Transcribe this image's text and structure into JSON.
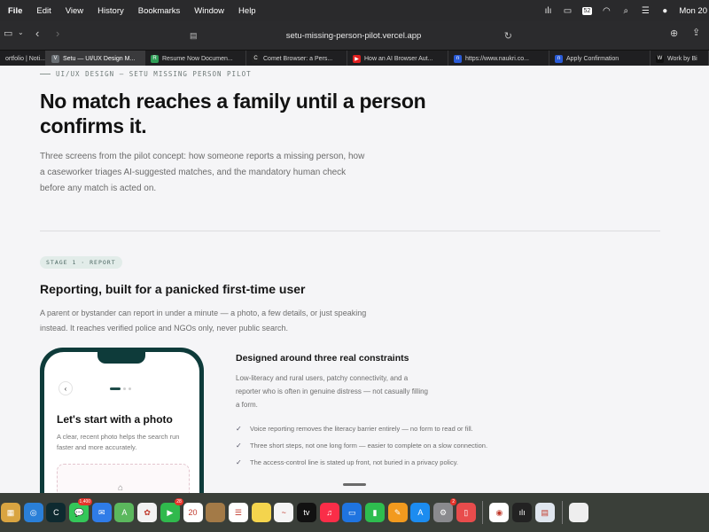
{
  "menubar": {
    "items": [
      "File",
      "Edit",
      "View",
      "History",
      "Bookmarks",
      "Window",
      "Help"
    ],
    "battery_badge": "52",
    "clock": "Mon 20"
  },
  "toolbar": {
    "url": "setu-missing-person-pilot.vercel.app"
  },
  "tabs": [
    {
      "label": "ortfolio | Noti...",
      "fav": "#444444",
      "glyph": "",
      "active": false
    },
    {
      "label": "Setu — UI/UX Design M...",
      "fav": "#6a6f74",
      "glyph": "V",
      "active": true
    },
    {
      "label": "Resume Now Documen...",
      "fav": "#2f9e57",
      "glyph": "R",
      "active": false
    },
    {
      "label": "Comet Browser: a Pers...",
      "fav": "#222222",
      "glyph": "C",
      "active": false
    },
    {
      "label": "How an AI Browser Aut...",
      "fav": "#e02020",
      "glyph": "▶",
      "active": false
    },
    {
      "label": "https://www.naukri.co...",
      "fav": "#2a5bd7",
      "glyph": "n",
      "active": false
    },
    {
      "label": "Apply Confirmation",
      "fav": "#2a5bd7",
      "glyph": "n",
      "active": false
    },
    {
      "label": "Work by Bi",
      "fav": "#111111",
      "glyph": "W",
      "active": false
    }
  ],
  "page": {
    "eyebrow": "UI/UX DESIGN — SETU MISSING PERSON PILOT",
    "hero_title": "No match reaches a family until a person confirms it.",
    "hero_sub": "Three screens from the pilot concept: how someone reports a missing person, how a caseworker triages AI-suggested matches, and the mandatory human check before any match is acted on.",
    "stage_label": "STAGE 1 · REPORT",
    "section_title": "Reporting, built for a panicked first-time user",
    "section_sub": "A parent or bystander can report in under a minute — a photo, a few details, or just speaking instead. It reaches verified police and NGOs only, never public search.",
    "phone": {
      "title": "Let's start with a photo",
      "subtitle": "A clear, recent photo helps the search run faster and more accurately."
    },
    "constraints": {
      "title": "Designed around three real constraints",
      "intro": "Low-literacy and rural users, patchy connectivity, and a reporter who is often in genuine distress — not casually filling a form.",
      "items": [
        "Voice reporting removes the literacy barrier entirely — no form to read or fill.",
        "Three short steps, not one long form — easier to complete on a slow connection.",
        "The access-control line is stated up front, not buried in a privacy policy."
      ]
    }
  },
  "dock": {
    "apps": [
      {
        "name": "launchpad-icon",
        "color": "#d9a441",
        "glyph": "▦",
        "badge": ""
      },
      {
        "name": "safari-icon",
        "color": "#2a7fd8",
        "glyph": "◎",
        "badge": ""
      },
      {
        "name": "comet-icon",
        "color": "#0e2a30",
        "glyph": "C",
        "badge": ""
      },
      {
        "name": "messages-icon",
        "color": "#34c759",
        "glyph": "💬",
        "badge": "1,400"
      },
      {
        "name": "mail-icon",
        "color": "#2f7ce8",
        "glyph": "✉",
        "badge": ""
      },
      {
        "name": "maps-icon",
        "color": "#5bb85d",
        "glyph": "A",
        "badge": ""
      },
      {
        "name": "photos-icon",
        "color": "#f2f2f2",
        "glyph": "✿",
        "badge": ""
      },
      {
        "name": "facetime-icon",
        "color": "#30b94d",
        "glyph": "▶",
        "badge": "28"
      },
      {
        "name": "calendar-icon",
        "color": "#ffffff",
        "glyph": "20",
        "badge": ""
      },
      {
        "name": "notes-brown-icon",
        "color": "#a37a47",
        "glyph": "",
        "badge": ""
      },
      {
        "name": "reminders-icon",
        "color": "#ffffff",
        "glyph": "☰",
        "badge": ""
      },
      {
        "name": "notes-icon",
        "color": "#f4d44d",
        "glyph": "",
        "badge": ""
      },
      {
        "name": "freeform-icon",
        "color": "#f5f5f5",
        "glyph": "~",
        "badge": ""
      },
      {
        "name": "apple-tv-icon",
        "color": "#111111",
        "glyph": "tv",
        "badge": ""
      },
      {
        "name": "music-icon",
        "color": "#fa2d48",
        "glyph": "♫",
        "badge": ""
      },
      {
        "name": "keynote-icon",
        "color": "#1f74e0",
        "glyph": "▭",
        "badge": ""
      },
      {
        "name": "numbers-icon",
        "color": "#2ebd4f",
        "glyph": "▮",
        "badge": ""
      },
      {
        "name": "pages-icon",
        "color": "#f29a1e",
        "glyph": "✎",
        "badge": ""
      },
      {
        "name": "app-store-icon",
        "color": "#1c8cf0",
        "glyph": "A",
        "badge": ""
      },
      {
        "name": "system-settings-icon",
        "color": "#8a8a8e",
        "glyph": "⚙",
        "badge": "2"
      },
      {
        "name": "iphone-mirroring-icon",
        "color": "#e84c4c",
        "glyph": "▯",
        "badge": ""
      },
      {
        "name": "chrome-icon",
        "color": "#ffffff",
        "glyph": "◉",
        "badge": ""
      },
      {
        "name": "audio-app-icon",
        "color": "#222222",
        "glyph": "ılı",
        "badge": ""
      },
      {
        "name": "preview-icon",
        "color": "#dfe6ee",
        "glyph": "▤",
        "badge": ""
      }
    ],
    "extra": {
      "name": "document-stack-icon",
      "color": "#eeeeee"
    }
  }
}
